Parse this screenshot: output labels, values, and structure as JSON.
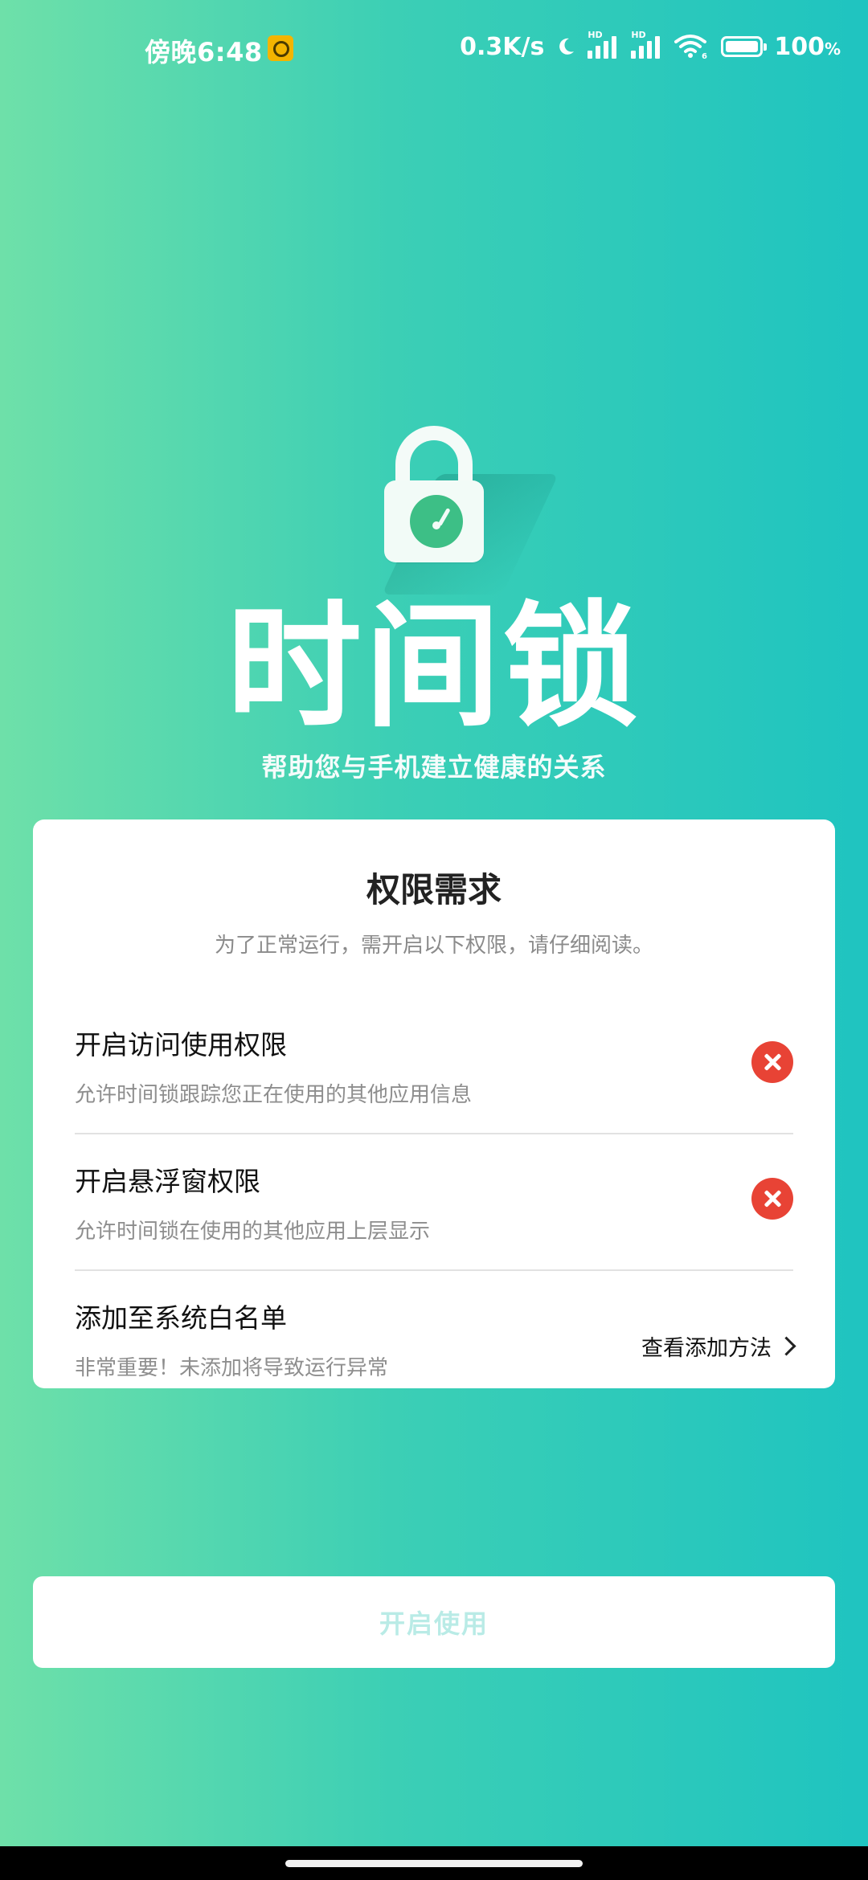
{
  "status_bar": {
    "time": "傍晚6:48",
    "network_speed": "0.3K/s",
    "moon_icon": "moon-icon",
    "signal_label_1": "HD",
    "signal_label_2": "HD",
    "wifi_badge": "6",
    "battery_text": "100",
    "battery_unit": "%"
  },
  "hero": {
    "title": "时间锁",
    "subtitle": "帮助您与手机建立健康的关系"
  },
  "card": {
    "title": "权限需求",
    "description": "为了正常运行，需开启以下权限，请仔细阅读。",
    "items": [
      {
        "title": "开启访问使用权限",
        "subtitle": "允许时间锁跟踪您正在使用的其他应用信息",
        "status_icon": "error-x-icon"
      },
      {
        "title": "开启悬浮窗权限",
        "subtitle": "允许时间锁在使用的其他应用上层显示",
        "status_icon": "error-x-icon"
      },
      {
        "title": "添加至系统白名单",
        "subtitle": "非常重要！未添加将导致运行异常",
        "action_label": "查看添加方法"
      }
    ]
  },
  "start_button": {
    "label": "开启使用"
  },
  "colors": {
    "gradient_start": "#6ee0a9",
    "gradient_end": "#1fc4c0",
    "error": "#e84335",
    "disabled_button_text": "#b9ebe6"
  }
}
